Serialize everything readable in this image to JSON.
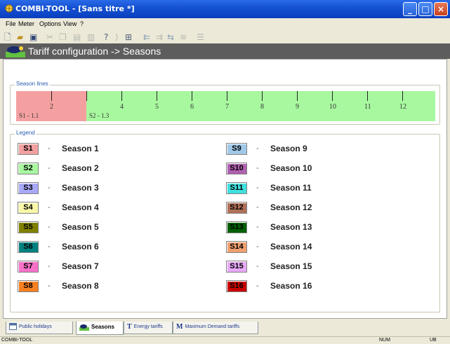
{
  "window": {
    "title": "COMBI-TOOL - [Sans titre *]",
    "min": "_",
    "max": "□",
    "close": "×"
  },
  "menu": [
    "File",
    "Meter",
    "Options",
    "View",
    "?"
  ],
  "header": {
    "title": "Tariff configuration -> Seasons"
  },
  "season_lines": {
    "title": "Season lines",
    "months": [
      "2",
      "4",
      "5",
      "6",
      "7",
      "8",
      "9",
      "10",
      "11",
      "12"
    ],
    "segments": [
      {
        "label": "S1 - 1.1",
        "color": "#f4a0a0"
      },
      {
        "label": "S2 - 1.3",
        "color": "#a8f8a0"
      }
    ]
  },
  "legend": {
    "title": "Legend",
    "dash": "-",
    "left": [
      {
        "code": "S1",
        "name": "Season 1",
        "color": "#f4a0a0"
      },
      {
        "code": "S2",
        "name": "Season 2",
        "color": "#a8f8a0"
      },
      {
        "code": "S3",
        "name": "Season 3",
        "color": "#a8a8f8"
      },
      {
        "code": "S4",
        "name": "Season 4",
        "color": "#f8f8a8"
      },
      {
        "code": "S5",
        "name": "Season 5",
        "color": "#808000"
      },
      {
        "code": "S6",
        "name": "Season 6",
        "color": "#008080"
      },
      {
        "code": "S7",
        "name": "Season 7",
        "color": "#f870c8"
      },
      {
        "code": "S8",
        "name": "Season 8",
        "color": "#f88020"
      }
    ],
    "right": [
      {
        "code": "S9",
        "name": "Season 9",
        "color": "#a0c8e8"
      },
      {
        "code": "S10",
        "name": "Season 10",
        "color": "#b060b0"
      },
      {
        "code": "S11",
        "name": "Season 11",
        "color": "#40e0e0"
      },
      {
        "code": "S12",
        "name": "Season 12",
        "color": "#b07058"
      },
      {
        "code": "S13",
        "name": "Season 13",
        "color": "#006000"
      },
      {
        "code": "S14",
        "name": "Season 14",
        "color": "#f0a070"
      },
      {
        "code": "S15",
        "name": "Season 15",
        "color": "#e8a8f8"
      },
      {
        "code": "S16",
        "name": "Season 16",
        "color": "#c80000"
      }
    ]
  },
  "tabs": [
    "Public holidays",
    "Seasons",
    "Energy tariffs",
    "Maximum Demand tariffs"
  ],
  "status": {
    "app": "COMBI-TOOL",
    "num": "NUM",
    "ub": "UB"
  }
}
